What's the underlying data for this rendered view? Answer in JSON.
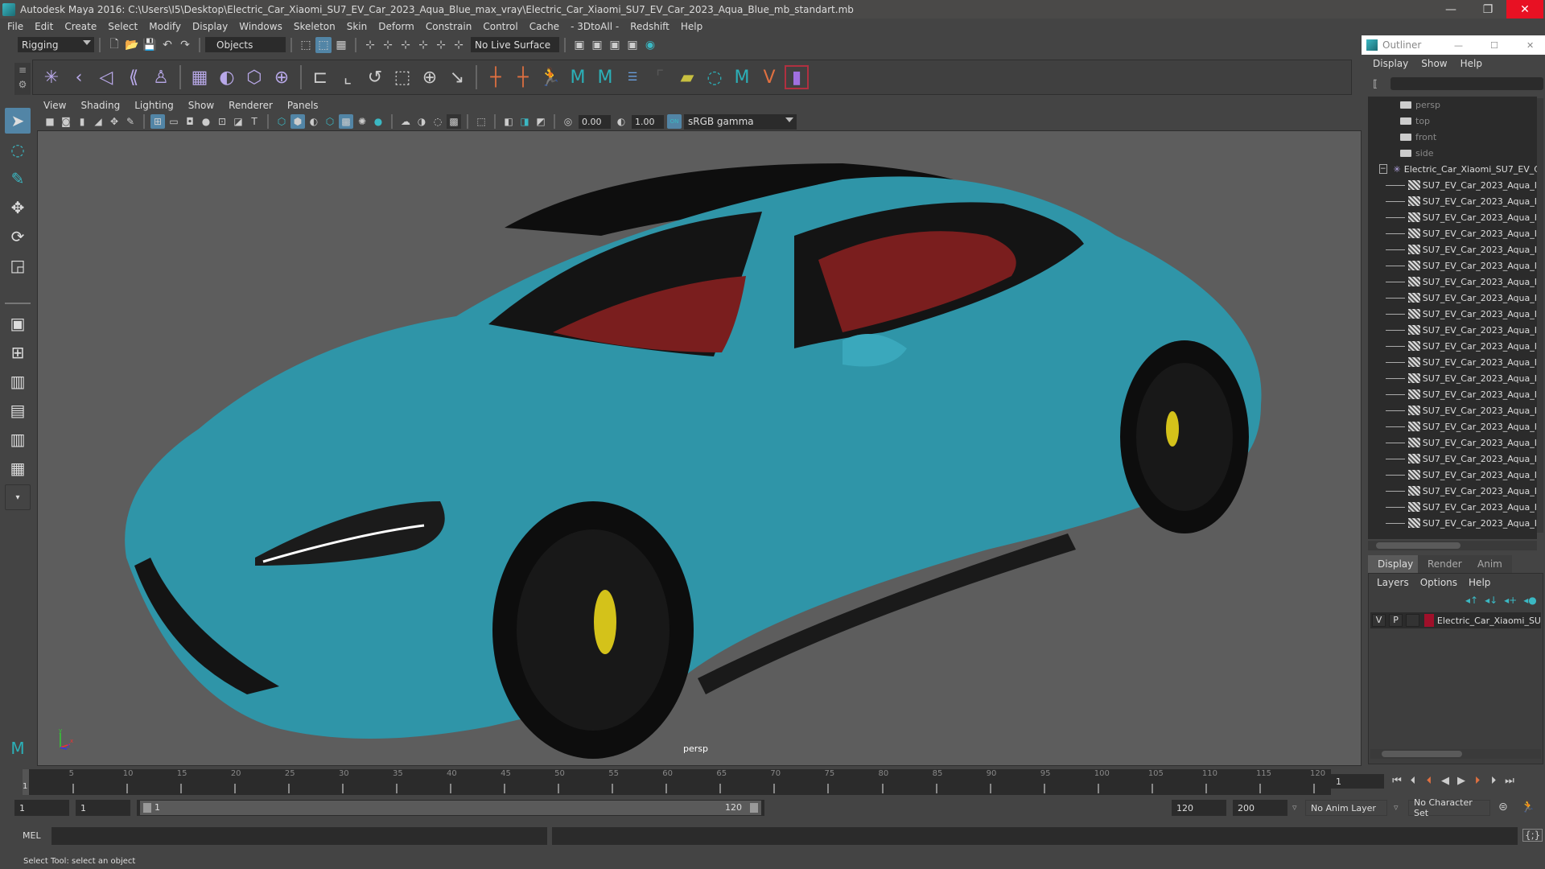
{
  "app": {
    "title": "Autodesk Maya 2016: C:\\Users\\I5\\Desktop\\Electric_Car_Xiaomi_SU7_EV_Car_2023_Aqua_Blue_max_vray\\Electric_Car_Xiaomi_SU7_EV_Car_2023_Aqua_Blue_mb_standart.mb",
    "window_controls": {
      "minimize": "—",
      "restore": "❐",
      "close": "✕"
    }
  },
  "menubar": [
    "File",
    "Edit",
    "Create",
    "Select",
    "Modify",
    "Display",
    "Windows",
    "Skeleton",
    "Skin",
    "Deform",
    "Constrain",
    "Control",
    "Cache",
    "- 3DtoAll -",
    "Redshift",
    "Help"
  ],
  "status_line": {
    "mode": "Rigging",
    "selection_mask": "Objects",
    "live_surface": "No Live Surface"
  },
  "shelf_icons": [
    "joint-tool",
    "ik-handle",
    "ik-spline",
    "skin-bind",
    "humanik",
    "paint-weights",
    "smooth-bind",
    "lattice",
    "cluster",
    "parent-constraint",
    "point-constraint",
    "orient-constraint",
    "scale-constraint",
    "aim-constraint",
    "pole-vector",
    "locator",
    "joint-orient",
    "hik-character",
    "maya-logo-1",
    "maya-logo-2",
    "outliner-list",
    "blank",
    "display-layer",
    "paint-select",
    "maya-logo-3",
    "polygon-vertex",
    "primitives"
  ],
  "viewport": {
    "menu": [
      "View",
      "Shading",
      "Lighting",
      "Show",
      "Renderer",
      "Panels"
    ],
    "exposure": "0.00",
    "gamma": "1.00",
    "color_mgmt_badge": "ON",
    "color_space": "sRGB gamma",
    "camera_label": "persp",
    "axis": {
      "x": "x",
      "y": "y",
      "z": "z"
    },
    "model_colors": {
      "body": "#2f95a8",
      "interior": "#7a1e1e",
      "trim": "#1a1a1a",
      "caliper": "#d4c21a"
    }
  },
  "outliner": {
    "title": "Outliner",
    "menu": [
      "Display",
      "Show",
      "Help"
    ],
    "cameras": [
      "persp",
      "top",
      "front",
      "side"
    ],
    "group": "Electric_Car_Xiaomi_SU7_EV_C",
    "children_label": "SU7_EV_Car_2023_Aqua_I",
    "children_count": 22
  },
  "layers": {
    "tabs": [
      "Display",
      "Render",
      "Anim"
    ],
    "active_tab": "Display",
    "menu": [
      "Layers",
      "Options",
      "Help"
    ],
    "items": [
      {
        "v": "V",
        "p": "P",
        "color": "#a0102a",
        "name": "Electric_Car_Xiaomi_SU"
      }
    ]
  },
  "timeline": {
    "ticks": [
      1,
      5,
      10,
      15,
      20,
      25,
      30,
      35,
      40,
      45,
      50,
      55,
      60,
      65,
      70,
      75,
      80,
      85,
      90,
      95,
      100,
      105,
      110,
      115,
      120
    ],
    "start": 1,
    "end": 120,
    "current_frame": "1"
  },
  "range": {
    "start": "1",
    "anim_start": "1",
    "slider_start": "1",
    "slider_end": "120",
    "end": "120",
    "anim_end": "200",
    "anim_layer": "No Anim Layer",
    "character_set": "No Character Set"
  },
  "command": {
    "label": "MEL"
  },
  "status": {
    "help": "Select Tool: select an object"
  }
}
